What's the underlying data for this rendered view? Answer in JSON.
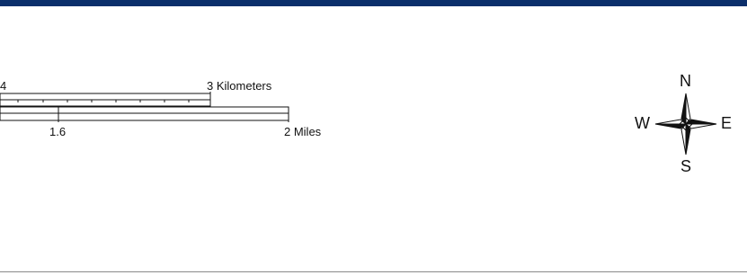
{
  "map": {
    "scale_bar": {
      "kilometers": {
        "left_tick_label": "4",
        "right_label": "3 Kilometers"
      },
      "miles": {
        "mid_tick_label": "1.6",
        "right_label": "2 Miles"
      }
    },
    "north_arrow": {
      "n": "N",
      "e": "E",
      "s": "S",
      "w": "W"
    }
  },
  "colors": {
    "top_band": "#0b2f6b",
    "text": "#111111"
  }
}
